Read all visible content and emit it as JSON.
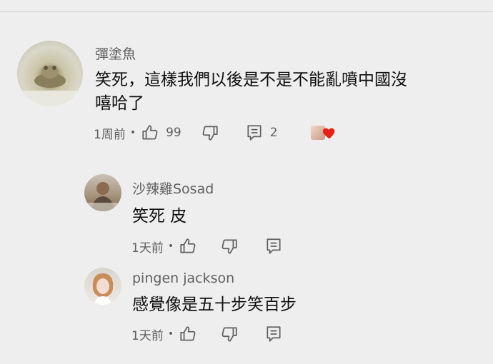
{
  "comments": [
    {
      "author": "彈塗魚",
      "text_line1": "笑死，這樣我們以後是不是不能亂噴中國沒",
      "text_line2": "嘻哈了",
      "time": "1周前",
      "likes": "99",
      "replies": "2"
    },
    {
      "author": "沙辣雞Sosad",
      "text": "笑死 皮",
      "time": "1天前"
    },
    {
      "author": "pingen jackson",
      "text": "感覺像是五十步笑百步",
      "time": "1天前"
    }
  ],
  "colors": {
    "heart": "#e62117",
    "meta_text": "#606060",
    "body_text": "#0f0f0f"
  },
  "icons": [
    "thumb-up-icon",
    "thumb-down-icon",
    "reply-icon",
    "creator-heart-icon"
  ]
}
